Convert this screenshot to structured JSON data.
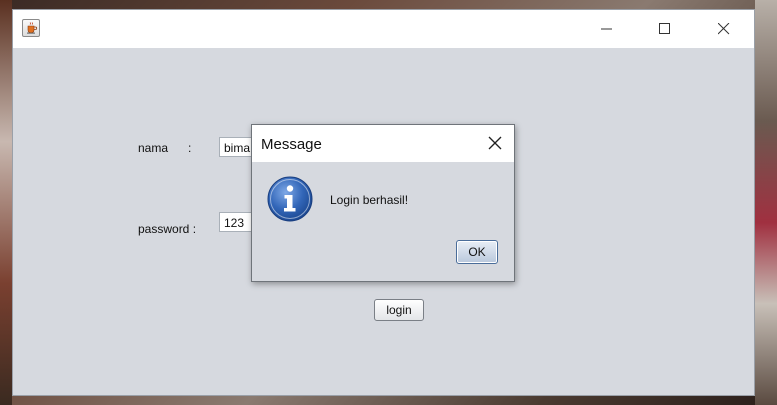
{
  "window": {
    "title": "",
    "icon": "java-cup-icon",
    "controls": [
      "minimize-icon",
      "maximize-icon",
      "close-icon"
    ]
  },
  "form": {
    "nama_label": "nama",
    "nama_colon": ":",
    "nama_value": "bima",
    "password_label": "password :",
    "password_value": "123",
    "login_label": "login"
  },
  "dialog": {
    "title": "Message",
    "icon": "info-icon",
    "message": "Login berhasil!",
    "ok_label": "OK"
  },
  "colors": {
    "window_bg": "#d6d9df",
    "titlebar_bg": "#ffffff",
    "info_blue": "#2a5fa8",
    "ok_border": "#4a6d9a"
  }
}
